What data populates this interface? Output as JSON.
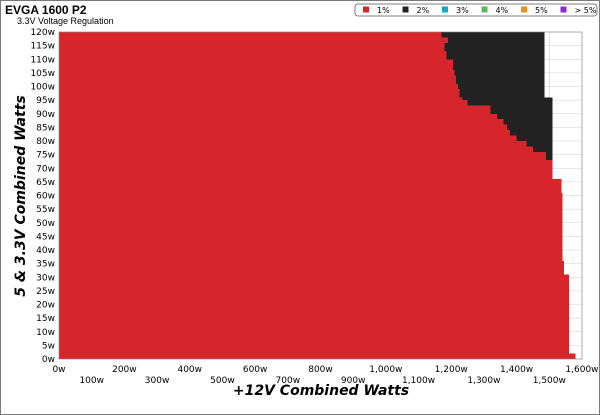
{
  "title": "EVGA 1600 P2",
  "subtitle": "3.3V Voltage Regulation",
  "chart_data": {
    "type": "heatmap",
    "title": "EVGA 1600 P2",
    "subtitle": "3.3V Voltage Regulation",
    "xlabel": "+12V Combined Watts",
    "ylabel": "5 & 3.3V Combined Watts",
    "xlim": [
      0,
      1600
    ],
    "ylim": [
      0,
      120
    ],
    "grid": true,
    "x_ticks_top": [
      "0w",
      "200w",
      "400w",
      "600w",
      "800w",
      "1,000w",
      "1,200w",
      "1,400w",
      "1,600w"
    ],
    "x_ticks_bottom": [
      "100w",
      "300w",
      "500w",
      "700w",
      "900w",
      "1,100w",
      "1,300w",
      "1,500w"
    ],
    "y_ticks": [
      "0w",
      "5w",
      "10w",
      "15w",
      "20w",
      "25w",
      "30w",
      "35w",
      "40w",
      "45w",
      "50w",
      "55w",
      "60w",
      "65w",
      "70w",
      "75w",
      "80w",
      "85w",
      "90w",
      "95w",
      "100w",
      "105w",
      "110w",
      "115w",
      "120w"
    ],
    "legend": {
      "placement": "top-right",
      "entries": [
        {
          "label": "1%",
          "color": "#d7262b"
        },
        {
          "label": "2%",
          "color": "#222222"
        },
        {
          "label": "3%",
          "color": "#1aa6c8"
        },
        {
          "label": "4%",
          "color": "#5cb85c"
        },
        {
          "label": "5%",
          "color": "#f0901e"
        },
        {
          "label": "> 5%",
          "color": "#8a2be2"
        }
      ]
    },
    "rows": [
      {
        "y": 0,
        "red_max": 1580,
        "black_max": null
      },
      {
        "y": 2,
        "red_max": 1560,
        "black_max": null
      },
      {
        "y": 31,
        "red_max": 1545,
        "black_max": null
      },
      {
        "y": 36,
        "red_max": 1540,
        "black_max": null
      },
      {
        "y": 45,
        "red_max": 1540,
        "black_max": null
      },
      {
        "y": 61,
        "red_max": 1538,
        "black_max": null
      },
      {
        "y": 66,
        "red_max": 1510,
        "black_max": null
      },
      {
        "y": 72,
        "red_max": 1510,
        "black_max": null
      },
      {
        "y": 73,
        "red_max": 1490,
        "black_max": 1510
      },
      {
        "y": 76,
        "red_max": 1450,
        "black_max": 1510
      },
      {
        "y": 78,
        "red_max": 1430,
        "black_max": 1510
      },
      {
        "y": 80,
        "red_max": 1400,
        "black_max": 1510
      },
      {
        "y": 82,
        "red_max": 1380,
        "black_max": 1510
      },
      {
        "y": 84,
        "red_max": 1370,
        "black_max": 1510
      },
      {
        "y": 86,
        "red_max": 1360,
        "black_max": 1510
      },
      {
        "y": 88,
        "red_max": 1340,
        "black_max": 1510
      },
      {
        "y": 90,
        "red_max": 1320,
        "black_max": 1510
      },
      {
        "y": 93,
        "red_max": 1250,
        "black_max": 1510
      },
      {
        "y": 95,
        "red_max": 1235,
        "black_max": 1510
      },
      {
        "y": 96,
        "red_max": 1225,
        "black_max": 1485
      },
      {
        "y": 99,
        "red_max": 1220,
        "black_max": 1485
      },
      {
        "y": 101,
        "red_max": 1215,
        "black_max": 1485
      },
      {
        "y": 104,
        "red_max": 1210,
        "black_max": 1485
      },
      {
        "y": 106,
        "red_max": 1205,
        "black_max": 1485
      },
      {
        "y": 110,
        "red_max": 1185,
        "black_max": 1485
      },
      {
        "y": 113,
        "red_max": 1180,
        "black_max": 1485
      },
      {
        "y": 116,
        "red_max": 1190,
        "black_max": 1485
      },
      {
        "y": 118,
        "red_max": 1170,
        "black_max": 1485
      }
    ]
  }
}
